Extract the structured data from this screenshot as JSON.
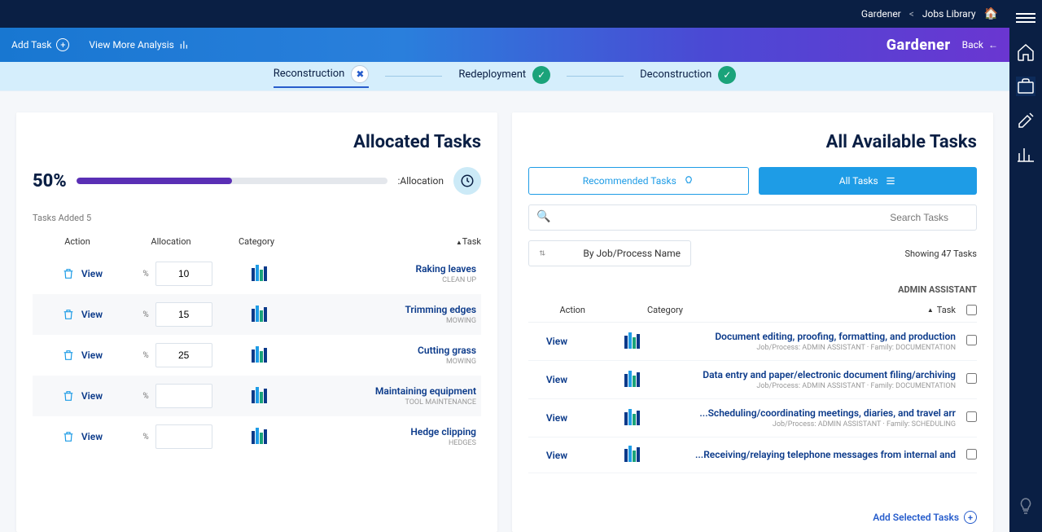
{
  "topbar": {
    "breadcrumb1": "Jobs Library",
    "breadcrumb2": "Gardener"
  },
  "ribbon": {
    "back": "Back",
    "brand": "Gardener",
    "view_more": "View More Analysis",
    "add_task": "Add Task"
  },
  "steps": {
    "deconstruction": "Deconstruction",
    "redeployment": "Redeployment",
    "reconstruction": "Reconstruction"
  },
  "left_panel": {
    "title": "All Available Tasks",
    "all_tasks": "All Tasks",
    "recommended": "Recommended Tasks",
    "search_placeholder": "Search Tasks",
    "showing": "Showing 47 Tasks",
    "sort_by": "By Job/Process Name",
    "group": "ADMIN ASSISTANT",
    "columns": {
      "task": "Task",
      "category": "Category",
      "action": "Action",
      "view": "View"
    },
    "rows": [
      {
        "title": "Document editing, proofing, formatting, and production",
        "sub": "Job/Process: ADMIN ASSISTANT · Family: DOCUMENTATION"
      },
      {
        "title": "Data entry and paper/electronic document filing/archiving",
        "sub": "Job/Process: ADMIN ASSISTANT · Family: DOCUMENTATION"
      },
      {
        "title": "Scheduling/coordinating meetings, diaries, and travel arr...",
        "sub": "Job/Process: ADMIN ASSISTANT · Family: SCHEDULING"
      },
      {
        "title": "Receiving/relaying telephone messages from internal and...",
        "sub": ""
      }
    ],
    "footer_add": "Add Selected Tasks"
  },
  "right_panel": {
    "title": "Allocated Tasks",
    "allocation_label": "Allocation:",
    "allocation_pct": 50,
    "allocation_pct_text": "50%",
    "tasks_added": "5 Tasks Added",
    "columns": {
      "task": "Task",
      "category": "Category",
      "allocation": "Allocation",
      "action": "Action",
      "view": "View",
      "pct": "%"
    },
    "rows": [
      {
        "title": "Raking leaves",
        "sub": "CLEAN UP",
        "alloc": "10"
      },
      {
        "title": "Trimming edges",
        "sub": "MOWING",
        "alloc": "15"
      },
      {
        "title": "Cutting grass",
        "sub": "MOWING",
        "alloc": "25"
      },
      {
        "title": "Maintaining equipment",
        "sub": "TOOL MAINTENANCE",
        "alloc": ""
      },
      {
        "title": "Hedge clipping",
        "sub": "HEDGES",
        "alloc": ""
      }
    ]
  }
}
